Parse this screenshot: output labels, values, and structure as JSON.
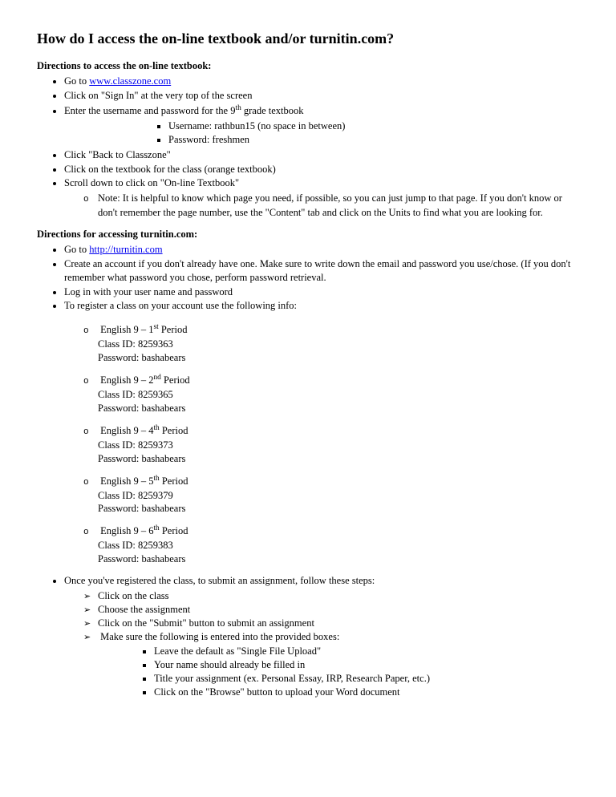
{
  "title": "How do I access the on-line textbook and/or turnitin.com?",
  "section1": {
    "heading": "Directions to access the on-line textbook:",
    "goto_prefix": "Go to ",
    "goto_link": "www.classzone.com",
    "signin": "Click on \"Sign In\" at the very top of the screen",
    "enter_creds_pre": "Enter the username and password for the 9",
    "enter_creds_sup": "th",
    "enter_creds_post": " grade textbook",
    "username": "Username: rathbun15 (no space in between)",
    "password": "Password: freshmen",
    "back": "Click \"Back to Classzone\"",
    "orange": "Click on the textbook for the class (orange textbook)",
    "scroll": "Scroll down to click on \"On-line Textbook\"",
    "note": "Note: It is helpful to know which page you need, if possible, so you can just jump to that page. If you don't know or don't remember the page number, use the \"Content\" tab and click on the Units to find what you are looking for."
  },
  "section2": {
    "heading": "Directions for accessing turnitin.com:",
    "goto_prefix": "Go to ",
    "goto_link": "http://turnitin.com",
    "create": "Create an account if you don't already have one.  Make sure to write down the email and password you use/chose. (If you don't remember what password you chose, perform password retrieval.",
    "login": "Log in with your user name and password",
    "register": "To register a class on your account use the following info:",
    "periods": [
      {
        "name_pre": "English 9 – 1",
        "sup": "st",
        "name_post": " Period",
        "id": "Class ID: 8259363",
        "pw": "Password: bashabears"
      },
      {
        "name_pre": "English 9 – 2",
        "sup": "nd",
        "name_post": " Period",
        "id": "Class ID: 8259365",
        "pw": "Password: bashabears"
      },
      {
        "name_pre": "English 9 – 4",
        "sup": "th",
        "name_post": " Period",
        "id": "Class ID: 8259373",
        "pw": "Password: bashabears"
      },
      {
        "name_pre": "English 9 – 5",
        "sup": "th",
        "name_post": " Period",
        "id": "Class ID: 8259379",
        "pw": "Password: bashabears"
      },
      {
        "name_pre": "English 9 – 6",
        "sup": "th",
        "name_post": " Period",
        "id": "Class ID: 8259383",
        "pw": "Password: bashabears"
      }
    ],
    "submit_intro": "Once you've registered the class, to submit an assignment, follow these steps:",
    "submit_steps": [
      "Click on the class",
      "Choose the assignment",
      "Click on the \"Submit\" button to submit an assignment",
      "Make sure the following is entered into the provided boxes:"
    ],
    "box_steps": [
      "Leave the default as \"Single File Upload\"",
      "Your name should already be filled in",
      "Title your assignment (ex. Personal Essay, IRP, Research Paper, etc.)",
      "Click on the \"Browse\" button to upload your Word document"
    ]
  }
}
